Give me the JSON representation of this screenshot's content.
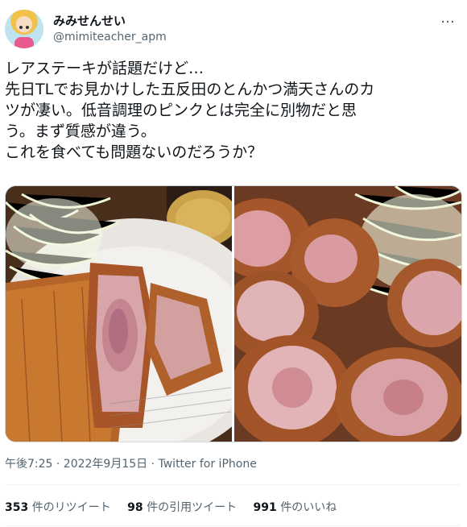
{
  "author": {
    "display_name": "みみせんせい",
    "handle": "@mimiteacher_apm"
  },
  "tweet": {
    "lines": [
      "レアステーキが話題だけど…",
      "先日TLでお見かけした五反田のとんかつ満天さんのカ",
      "ツが凄い。低音調理のピンクとは完全に別物だと思",
      "う。まず質感が違う。",
      "これを食べても問題ないのだろうか？"
    ]
  },
  "more_icon": "…",
  "meta": {
    "text": "午後7:25 · 2022年9月15日 · Twitter for iPhone"
  },
  "stats": {
    "retweets_count": "353",
    "retweets_label": "件のリツイート",
    "quotes_count": "98",
    "quotes_label": "件の引用ツイート",
    "likes_count": "991",
    "likes_label": "件のいいね"
  },
  "colors": {
    "text": "#0f1419",
    "secondary": "#536471"
  }
}
